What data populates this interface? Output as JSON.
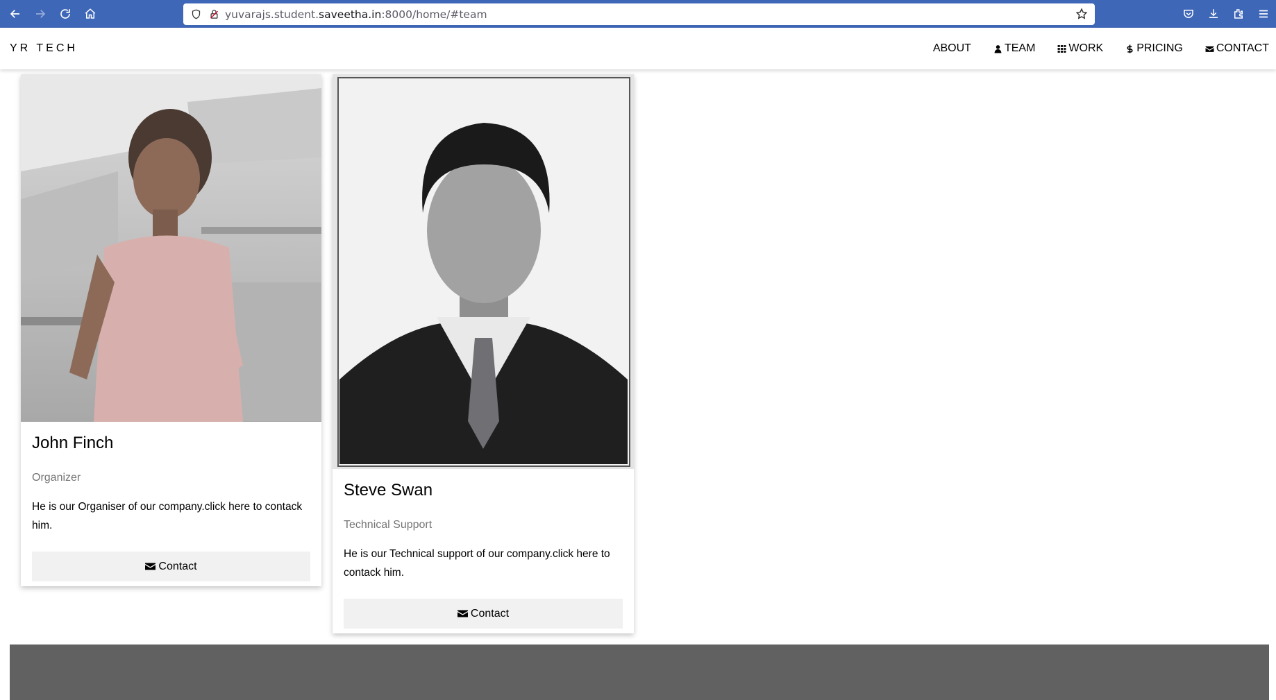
{
  "browser": {
    "url_pre": "yuvarajs.student.",
    "url_domain": "saveetha.in",
    "url_post": ":8000/home/#team",
    "icons": [
      "back-icon",
      "forward-icon",
      "reload-icon",
      "home-icon",
      "shield-icon",
      "lock-icon",
      "star-icon",
      "pocket-icon",
      "download-icon",
      "extensions-icon",
      "hamburger-menu-icon"
    ]
  },
  "site": {
    "logo": "YR TECH",
    "menu": [
      {
        "label": "ABOUT",
        "icon": ""
      },
      {
        "label": "TEAM",
        "icon": "user-icon"
      },
      {
        "label": "WORK",
        "icon": "grid-icon"
      },
      {
        "label": "PRICING",
        "icon": "dollar-icon"
      },
      {
        "label": "CONTACT",
        "icon": "envelope-icon"
      }
    ]
  },
  "team": [
    {
      "name": "John Finch",
      "role": "Organizer",
      "description": "He is our Organiser of our company.click here to contack him.",
      "button": "Contact"
    },
    {
      "name": "Steve Swan",
      "role": "Technical Support",
      "description": "He is our Technical support of our company.click here to contack him.",
      "button": "Contact"
    }
  ],
  "colors": {
    "browser_bar": "#3f67b8",
    "footer": "#616161",
    "button_bg": "#f1f1f1",
    "role_text": "#757575"
  }
}
